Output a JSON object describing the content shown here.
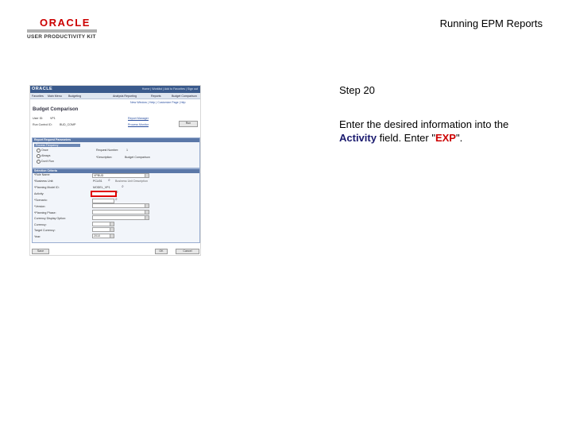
{
  "logo": {
    "oracle": "ORACLE",
    "product": "USER PRODUCTIVITY KIT"
  },
  "doc_title": "Running EPM Reports",
  "step": {
    "label": "Step 20"
  },
  "instruction": {
    "prefix": "Enter the desired information into the",
    "field_name": "Activity",
    "middle": "field. Enter \"",
    "value": "EXP",
    "suffix": "\"."
  },
  "screenshot": {
    "app_logo": "ORACLE",
    "top_nav": "Home  |  Worklist  |  Add to Favorites  |  Sign out",
    "breadcrumb": [
      "Favorites",
      "Main Menu",
      "Budgeting",
      "Analysis Reporting",
      "Reports",
      "Budget Comparison"
    ],
    "toolbar": "New Window  |  Help  |  Customize Page  |  http",
    "page_title": "Budget Comparison",
    "user_id_label": "User ID:",
    "user_id": "VP1",
    "run_control_label": "Run Control ID:",
    "run_control": "BUD_COMP",
    "report_manager": "Report Manager",
    "process_monitor": "Process Monitor",
    "run_button": "Run",
    "section1": "Report Request Parameters",
    "frequency_header": "Process Frequency",
    "frequency_options": [
      "Once",
      "Always",
      "Don't Run"
    ],
    "request_number_label": "Request Number:",
    "request_number": "1",
    "description_label": "*Description:",
    "description": "Budget Comparison",
    "section2": "Selection Criteria",
    "criteria": [
      {
        "label": "*Rule Name:",
        "value": "VPBUD"
      },
      {
        "label": "*Business Unit:",
        "value": "PCU01"
      },
      {
        "label": "*Planning Model ID:",
        "value": "MODEL_VP1"
      },
      {
        "label": "Activity:",
        "value": ""
      },
      {
        "label": "*Scenario:",
        "value": ""
      },
      {
        "label": "*Version:",
        "value": ""
      },
      {
        "label": "*Planning Phase:",
        "value": ""
      },
      {
        "label": "Currency Display Option:",
        "value": ""
      },
      {
        "label": "Currency:",
        "value": ""
      },
      {
        "label": "Target Currency:",
        "value": ""
      },
      {
        "label": "Year:",
        "value": "2010"
      }
    ],
    "unit_desc": "Business Unit Description",
    "save_button": "Save",
    "ok_button": "OK",
    "cancel_button": "Cancel"
  }
}
